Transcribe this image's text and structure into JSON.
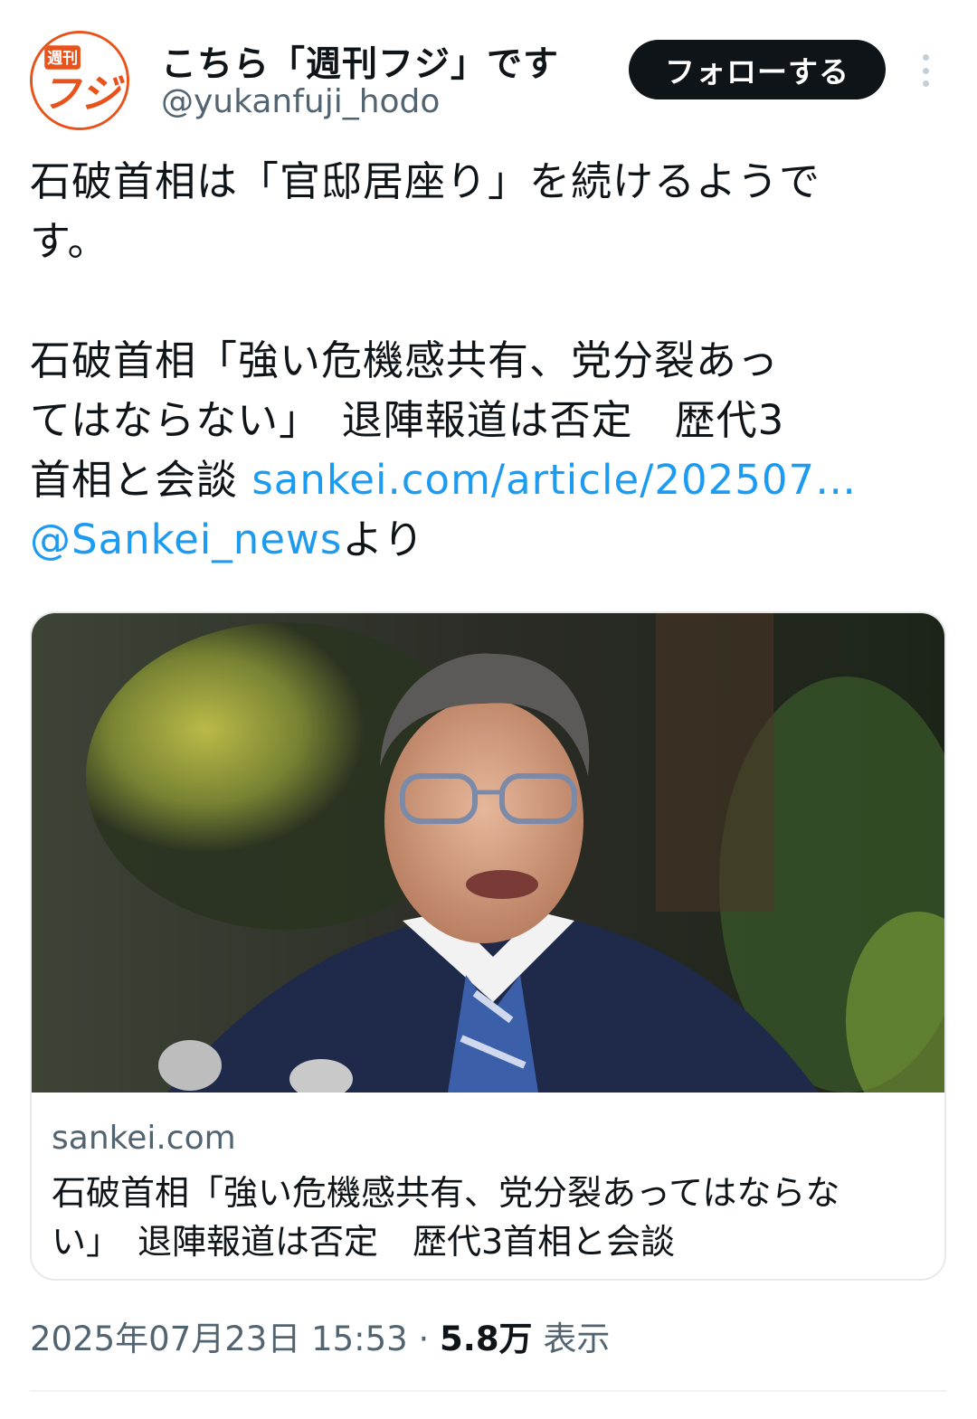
{
  "author": {
    "display_name": "こちら「週刊フジ」です",
    "handle": "@yukanfuji_hodo",
    "avatar_text_top": "週刊",
    "avatar_text_main": "フジ"
  },
  "actions": {
    "follow_label": "フォローする",
    "more_icon": "more-vertical-icon"
  },
  "tweet": {
    "line1": "石破首相は「官邸居座り」を続けるようで\nす。",
    "line2": "石破首相「強い危機感共有、党分裂あっ\nてはならない」　退陣報道は否定　歴代3\n首相と会談 ",
    "link_url": "sankei.com/article/202507…",
    "mention": "@Sankei_news",
    "mention_suffix": "より"
  },
  "card": {
    "domain": "sankei.com",
    "title": "石破首相「強い危機感共有、党分裂あってはならな\nい」　退陣報道は否定　歴代3首相と会談"
  },
  "meta": {
    "timestamp": "2025年07月23日 15:53",
    "separator": " · ",
    "views": "5.8万",
    "views_label": " 表示"
  },
  "colors": {
    "link": "#1d9bf0",
    "follow_bg": "#0f1419",
    "secondary": "#536471",
    "brand": "#e8531c"
  }
}
